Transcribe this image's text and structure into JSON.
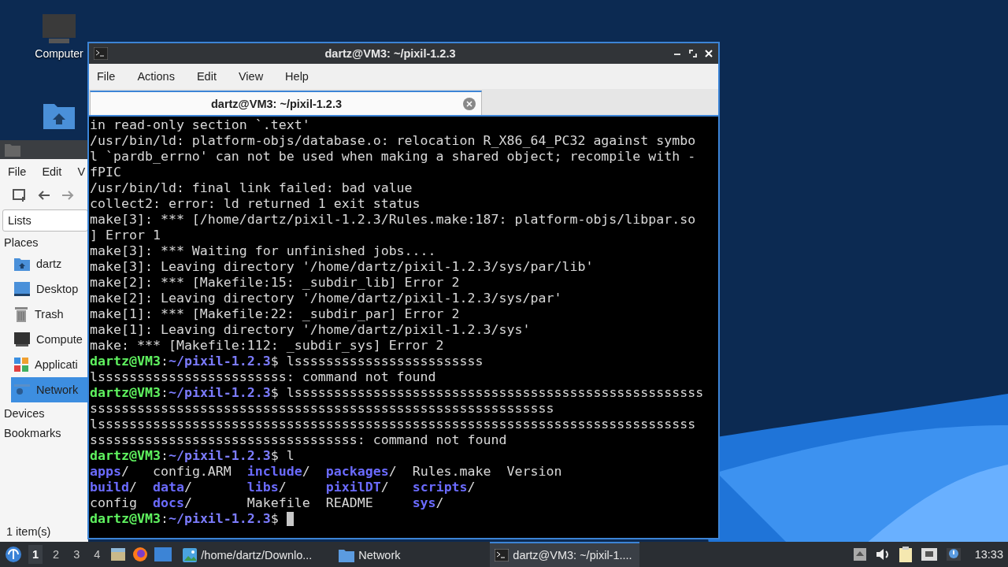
{
  "desktop": {
    "icons": [
      {
        "kind": "computer",
        "label": "Computer"
      },
      {
        "kind": "home"
      }
    ]
  },
  "file_manager": {
    "menu": [
      "File",
      "Edit",
      "V"
    ],
    "location": "Lists",
    "sections": [
      {
        "title": "Places",
        "items": [
          {
            "label": "dartz",
            "kind": "home",
            "selected": false
          },
          {
            "label": "Desktop",
            "kind": "desktop",
            "selected": false
          },
          {
            "label": "Trash",
            "kind": "trash",
            "selected": false
          },
          {
            "label": "Compute",
            "kind": "computer",
            "selected": false
          },
          {
            "label": "Applicati",
            "kind": "apps",
            "selected": false
          },
          {
            "label": "Network",
            "kind": "network",
            "selected": true
          }
        ]
      },
      {
        "title": "Devices"
      },
      {
        "title": "Bookmarks"
      }
    ],
    "status": "1 item(s)"
  },
  "terminal": {
    "title": "dartz@VM3: ~/pixil-1.2.3",
    "menu": [
      "File",
      "Actions",
      "Edit",
      "View",
      "Help"
    ],
    "tabs": [
      {
        "label": "dartz@VM3: ~/pixil-1.2.3",
        "selected": true
      }
    ],
    "lines": [
      {
        "segments": [
          {
            "text": "in read-only section `.text'",
            "kind": "plain"
          }
        ]
      },
      {
        "segments": [
          {
            "text": "/usr/bin/ld: platform-objs/database.o: relocation R_X86_64_PC32 against symbo",
            "kind": "plain"
          }
        ]
      },
      {
        "segments": [
          {
            "text": "l `pardb_errno' can not be used when making a shared object; recompile with -",
            "kind": "plain"
          }
        ]
      },
      {
        "segments": [
          {
            "text": "fPIC",
            "kind": "plain"
          }
        ]
      },
      {
        "segments": [
          {
            "text": "/usr/bin/ld: final link failed: bad value",
            "kind": "plain"
          }
        ]
      },
      {
        "segments": [
          {
            "text": "collect2: error: ld returned 1 exit status",
            "kind": "plain"
          }
        ]
      },
      {
        "segments": [
          {
            "text": "make[3]: *** [/home/dartz/pixil-1.2.3/Rules.make:187: platform-objs/libpar.so",
            "kind": "plain"
          }
        ]
      },
      {
        "segments": [
          {
            "text": "] Error 1",
            "kind": "plain"
          }
        ]
      },
      {
        "segments": [
          {
            "text": "make[3]: *** Waiting for unfinished jobs....",
            "kind": "plain"
          }
        ]
      },
      {
        "segments": [
          {
            "text": "make[3]: Leaving directory '/home/dartz/pixil-1.2.3/sys/par/lib'",
            "kind": "plain"
          }
        ]
      },
      {
        "segments": [
          {
            "text": "make[2]: *** [Makefile:15: _subdir_lib] Error 2",
            "kind": "plain"
          }
        ]
      },
      {
        "segments": [
          {
            "text": "make[2]: Leaving directory '/home/dartz/pixil-1.2.3/sys/par'",
            "kind": "plain"
          }
        ]
      },
      {
        "segments": [
          {
            "text": "make[1]: *** [Makefile:22: _subdir_par] Error 2",
            "kind": "plain"
          }
        ]
      },
      {
        "segments": [
          {
            "text": "make[1]: Leaving directory '/home/dartz/pixil-1.2.3/sys'",
            "kind": "plain"
          }
        ]
      },
      {
        "segments": [
          {
            "text": "make: *** [Makefile:112: _subdir_sys] Error 2",
            "kind": "plain"
          }
        ]
      },
      {
        "segments": [
          {
            "text": "dartz@VM3",
            "kind": "user"
          },
          {
            "text": ":",
            "kind": "plain"
          },
          {
            "text": "~/pixil-1.2.3",
            "kind": "path"
          },
          {
            "text": "$ lssssssssssssssssssssssss",
            "kind": "plain"
          }
        ]
      },
      {
        "segments": [
          {
            "text": "lssssssssssssssssssssssss: command not found",
            "kind": "plain"
          }
        ]
      },
      {
        "segments": [
          {
            "text": "dartz@VM3",
            "kind": "user"
          },
          {
            "text": ":",
            "kind": "plain"
          },
          {
            "text": "~/pixil-1.2.3",
            "kind": "path"
          },
          {
            "text": "$ lssssssssssssssssssssssssssssssssssssssssssssssssssss",
            "kind": "plain"
          }
        ]
      },
      {
        "segments": [
          {
            "text": "sssssssssssssssssssssssssssssssssssssssssssssssssssssssssss",
            "kind": "plain"
          }
        ]
      },
      {
        "segments": [
          {
            "text": "lssssssssssssssssssssssssssssssssssssssssssssssssssssssssssssssssssssssssssss",
            "kind": "plain"
          }
        ]
      },
      {
        "segments": [
          {
            "text": "ssssssssssssssssssssssssssssssssss: command not found",
            "kind": "plain"
          }
        ]
      },
      {
        "segments": [
          {
            "text": "dartz@VM3",
            "kind": "user"
          },
          {
            "text": ":",
            "kind": "plain"
          },
          {
            "text": "~/pixil-1.2.3",
            "kind": "path"
          },
          {
            "text": "$ l",
            "kind": "plain"
          }
        ]
      },
      {
        "segments": [
          {
            "text": "apps",
            "kind": "dir"
          },
          {
            "text": "/   config.ARM  ",
            "kind": "plain"
          },
          {
            "text": "include",
            "kind": "dir"
          },
          {
            "text": "/  ",
            "kind": "plain"
          },
          {
            "text": "packages",
            "kind": "dir"
          },
          {
            "text": "/  Rules.make  Version",
            "kind": "plain"
          }
        ]
      },
      {
        "segments": [
          {
            "text": "build",
            "kind": "dir"
          },
          {
            "text": "/  ",
            "kind": "plain"
          },
          {
            "text": "data",
            "kind": "dir"
          },
          {
            "text": "/       ",
            "kind": "plain"
          },
          {
            "text": "libs",
            "kind": "dir"
          },
          {
            "text": "/     ",
            "kind": "plain"
          },
          {
            "text": "pixilDT",
            "kind": "dir"
          },
          {
            "text": "/   ",
            "kind": "plain"
          },
          {
            "text": "scripts",
            "kind": "dir"
          },
          {
            "text": "/",
            "kind": "plain"
          }
        ]
      },
      {
        "segments": [
          {
            "text": "config  ",
            "kind": "plain"
          },
          {
            "text": "docs",
            "kind": "dir"
          },
          {
            "text": "/       Makefile  README     ",
            "kind": "plain"
          },
          {
            "text": "sys",
            "kind": "dir"
          },
          {
            "text": "/",
            "kind": "plain"
          }
        ]
      },
      {
        "segments": [
          {
            "text": "dartz@VM3",
            "kind": "user"
          },
          {
            "text": ":",
            "kind": "plain"
          },
          {
            "text": "~/pixil-1.2.3",
            "kind": "path"
          },
          {
            "text": "$ ",
            "kind": "plain"
          }
        ],
        "cursor": true
      }
    ]
  },
  "taskbar": {
    "workspaces": [
      {
        "label": "1",
        "selected": true
      },
      {
        "label": "2",
        "selected": false
      },
      {
        "label": "3",
        "selected": false
      },
      {
        "label": "4",
        "selected": false
      }
    ],
    "tasks": [
      {
        "label": "/home/dartz/Downlo...",
        "kind": "image",
        "selected": false
      },
      {
        "label": "Network",
        "kind": "folder",
        "selected": false
      },
      {
        "label": "dartz@VM3: ~/pixil-1....",
        "kind": "terminal",
        "selected": true
      }
    ],
    "clock": "13:33"
  }
}
